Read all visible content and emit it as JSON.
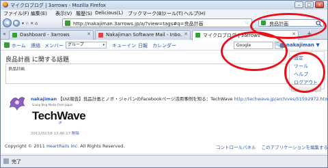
{
  "window": {
    "title": "マイクロブログ | 3arrows - Mozilla Firefox",
    "minimize": "–",
    "maximize": "□",
    "close": "×"
  },
  "menu": [
    "ファイル(F)",
    "編集(E)",
    "表示(V)",
    "履歴(S)",
    "Delicious(L)",
    "ブックマーク(B)",
    "ツール(T)",
    "ヘルプ(H)"
  ],
  "nav": {
    "back": "◀",
    "forward": "▶",
    "dropdown": "▾ ☆ ✕ ⌂",
    "url": "http://nakajiman.3arrows.jp/a/?view=tags#q=良品計画",
    "star": "☆",
    "search_value": "良品計画",
    "search_icon": "search-icon"
  },
  "tabs": [
    {
      "label": "Dashboard - 3arrows",
      "color": "#3a9d3a",
      "close": "✕"
    },
    {
      "label": "Nakajiman Software Mail - Inbo...",
      "color": "#d44",
      "close": "✕"
    },
    {
      "label": "マイクロブログ | 3arrows",
      "color": "#3a9d3a",
      "close": "✕"
    }
  ],
  "tab_scroll": "«",
  "new_tab": "+",
  "site_nav": {
    "home": "ホーム",
    "contacts": "連絡",
    "members": "メンバー",
    "group": "グループ",
    "group_arrow": "▾",
    "queue": "キューイン",
    "calendar_day": "日報",
    "calendar": "カレンダー",
    "search_value": "Google",
    "search_btn": "🔍",
    "user": "nakajiman",
    "user_arrow": "▼"
  },
  "user_menu": [
    "設定",
    "ツール",
    "ヘルプ",
    "ログアウト"
  ],
  "heading": {
    "keyword": "良品計画",
    "suffix": " に関する話題"
  },
  "postbox": {
    "text": "良品計画"
  },
  "entry": {
    "user": "nakajiman",
    "text": " 【Ust報告】良品計画とノボ・ジャパンのFacebookページ活用事例を知る：TechWave ",
    "link": "http://techwave.jp/archives/51592972.html",
    "thumb_tiny": "Scoop Blog Media From Japan",
    "thumb_brand": "TechWave",
    "thumb_jp": ".JP",
    "timestamp": "2011/02/18 13:46:17 ",
    "delete": "削除"
  },
  "footer": {
    "copyright": "Copyright © 2011 ",
    "company": "HeartRails Inc.",
    "rights": " All Rights Reserved.",
    "control_panel": "コントロールパネル",
    "about": "このアプリケーションを編集する"
  },
  "status": {
    "text": "完了"
  }
}
